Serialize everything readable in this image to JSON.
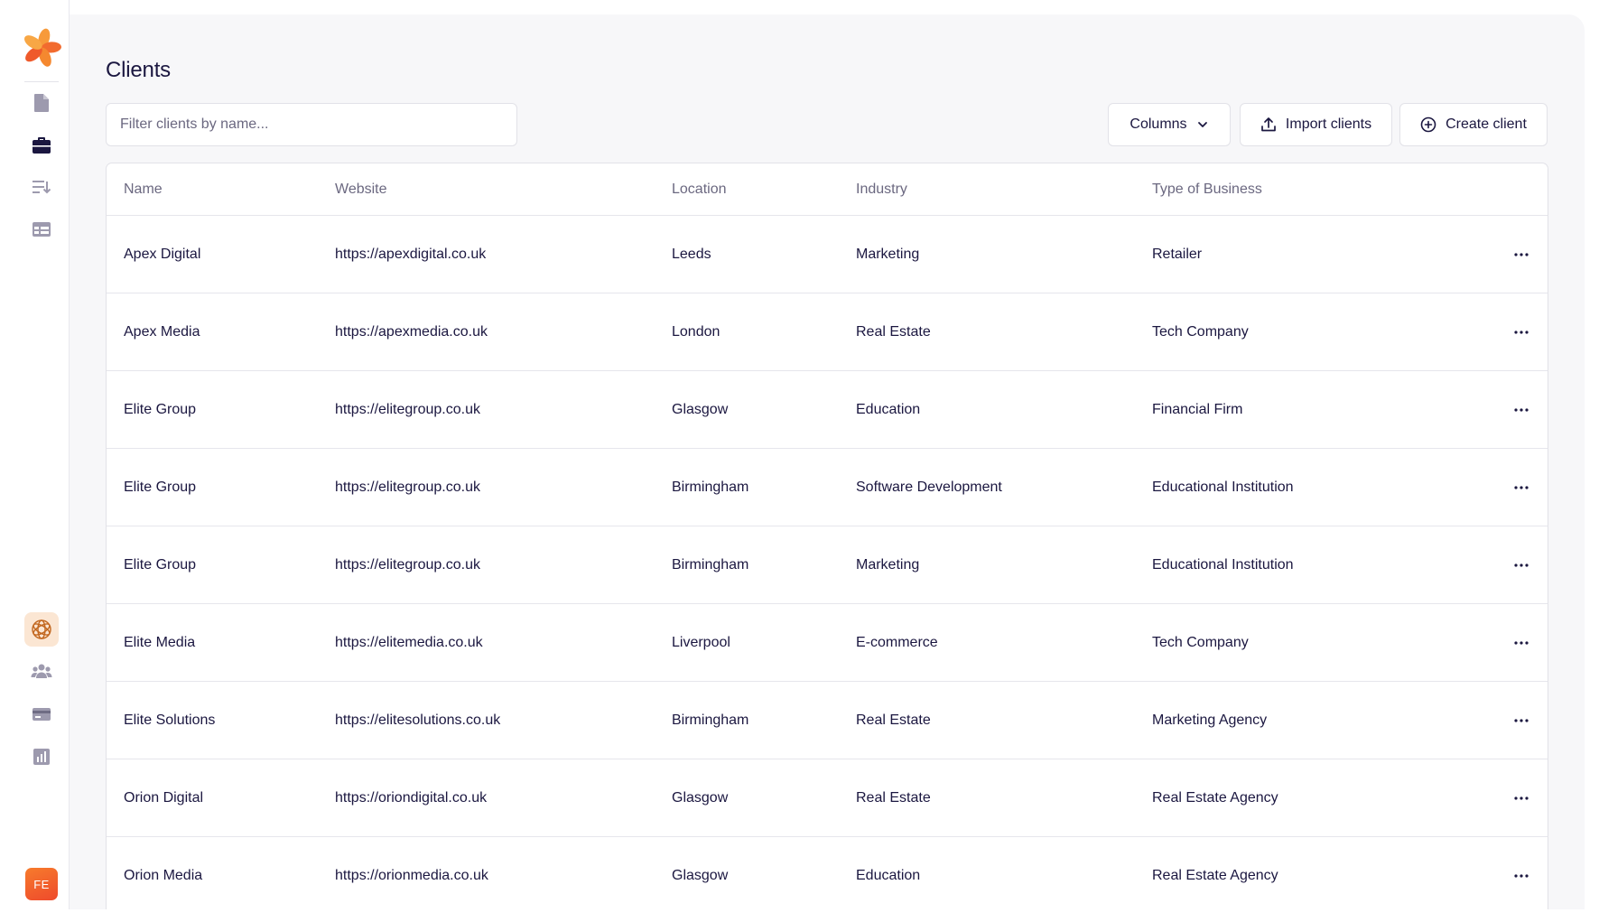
{
  "app": {
    "logo_icon": "brand-flower-logo",
    "brand_colors": {
      "orange": "#f77b2c",
      "red": "#ee4a2c",
      "ink": "#1b1740",
      "muted": "#6b6880"
    }
  },
  "sidebar": {
    "top_items": [
      {
        "icon": "document-icon"
      },
      {
        "icon": "briefcase-icon",
        "active": true
      },
      {
        "icon": "sort-list-icon"
      },
      {
        "icon": "table-icon"
      }
    ],
    "bottom_items": [
      {
        "icon": "ai-assistant-icon"
      },
      {
        "icon": "team-icon"
      },
      {
        "icon": "credit-card-icon"
      },
      {
        "icon": "bar-chart-icon"
      }
    ],
    "avatar_initials": "FE"
  },
  "page": {
    "title": "Clients",
    "search_placeholder": "Filter clients by name...",
    "columns_label": "Columns",
    "import_label": "Import clients",
    "create_label": "Create client"
  },
  "table": {
    "headers": [
      "Name",
      "Website",
      "Location",
      "Industry",
      "Type of Business"
    ],
    "rows": [
      {
        "name": "Apex Digital",
        "website": "https://apexdigital.co.uk",
        "location": "Leeds",
        "industry": "Marketing",
        "type": "Retailer"
      },
      {
        "name": "Apex Media",
        "website": "https://apexmedia.co.uk",
        "location": "London",
        "industry": "Real Estate",
        "type": "Tech Company"
      },
      {
        "name": "Elite Group",
        "website": "https://elitegroup.co.uk",
        "location": "Glasgow",
        "industry": "Education",
        "type": "Financial Firm"
      },
      {
        "name": "Elite Group",
        "website": "https://elitegroup.co.uk",
        "location": "Birmingham",
        "industry": "Software Development",
        "type": "Educational Institution"
      },
      {
        "name": "Elite Group",
        "website": "https://elitegroup.co.uk",
        "location": "Birmingham",
        "industry": "Marketing",
        "type": "Educational Institution"
      },
      {
        "name": "Elite Media",
        "website": "https://elitemedia.co.uk",
        "location": "Liverpool",
        "industry": "E-commerce",
        "type": "Tech Company"
      },
      {
        "name": "Elite Solutions",
        "website": "https://elitesolutions.co.uk",
        "location": "Birmingham",
        "industry": "Real Estate",
        "type": "Marketing Agency"
      },
      {
        "name": "Orion Digital",
        "website": "https://oriondigital.co.uk",
        "location": "Glasgow",
        "industry": "Real Estate",
        "type": "Real Estate Agency"
      },
      {
        "name": "Orion Media",
        "website": "https://orionmedia.co.uk",
        "location": "Glasgow",
        "industry": "Education",
        "type": "Real Estate Agency"
      }
    ]
  }
}
